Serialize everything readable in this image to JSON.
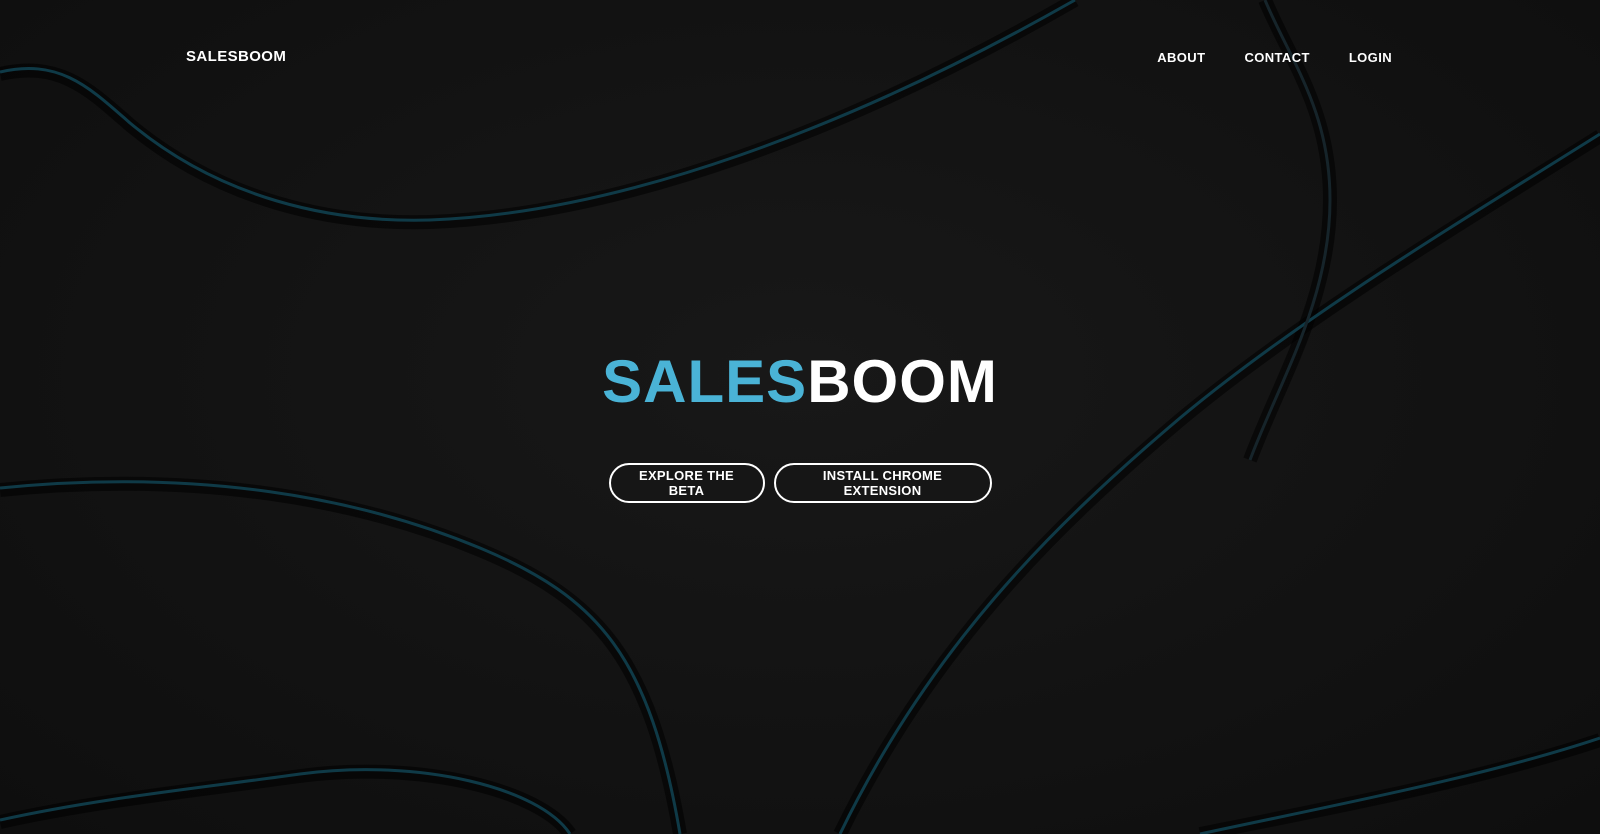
{
  "brand": {
    "logo_text": "SALESBOOM"
  },
  "nav": {
    "links": [
      {
        "label": "ABOUT"
      },
      {
        "label": "CONTACT"
      },
      {
        "label": "LOGIN"
      }
    ]
  },
  "hero": {
    "title_accent": "SALES",
    "title_rest": "BOOM"
  },
  "actions": {
    "explore_label": "EXPLORE THE BETA",
    "install_label": "INSTALL CHROME EXTENSION"
  },
  "colors": {
    "background": "#121212",
    "accent": "#4ab3d6",
    "line": "#0f3a47",
    "text": "#ffffff"
  }
}
